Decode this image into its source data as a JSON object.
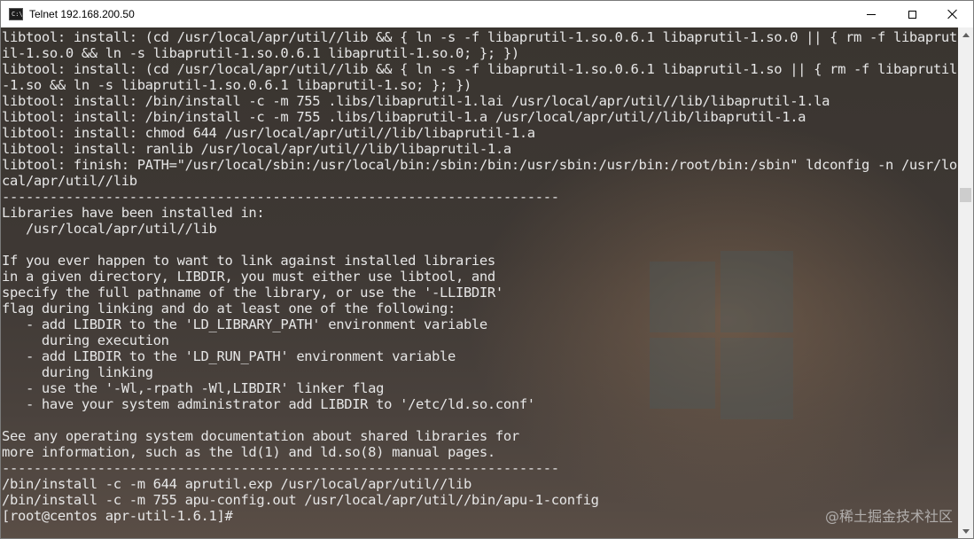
{
  "window": {
    "title": "Telnet 192.168.200.50",
    "app_icon_text": "C:\\",
    "controls": [
      "minimize",
      "maximize",
      "close"
    ]
  },
  "terminal": {
    "lines": [
      "libtool: install: (cd /usr/local/apr/util//lib && { ln -s -f libaprutil-1.so.0.6.1 libaprutil-1.so.0 || { rm -f libaprut",
      "il-1.so.0 && ln -s libaprutil-1.so.0.6.1 libaprutil-1.so.0; }; })",
      "libtool: install: (cd /usr/local/apr/util//lib && { ln -s -f libaprutil-1.so.0.6.1 libaprutil-1.so || { rm -f libaprutil",
      "-1.so && ln -s libaprutil-1.so.0.6.1 libaprutil-1.so; }; })",
      "libtool: install: /bin/install -c -m 755 .libs/libaprutil-1.lai /usr/local/apr/util//lib/libaprutil-1.la",
      "libtool: install: /bin/install -c -m 755 .libs/libaprutil-1.a /usr/local/apr/util//lib/libaprutil-1.a",
      "libtool: install: chmod 644 /usr/local/apr/util//lib/libaprutil-1.a",
      "libtool: install: ranlib /usr/local/apr/util//lib/libaprutil-1.a",
      "libtool: finish: PATH=\"/usr/local/sbin:/usr/local/bin:/sbin:/bin:/usr/sbin:/usr/bin:/root/bin:/sbin\" ldconfig -n /usr/lo",
      "cal/apr/util//lib",
      "----------------------------------------------------------------------",
      "Libraries have been installed in:",
      "   /usr/local/apr/util//lib",
      "",
      "If you ever happen to want to link against installed libraries",
      "in a given directory, LIBDIR, you must either use libtool, and",
      "specify the full pathname of the library, or use the '-LLIBDIR'",
      "flag during linking and do at least one of the following:",
      "   - add LIBDIR to the 'LD_LIBRARY_PATH' environment variable",
      "     during execution",
      "   - add LIBDIR to the 'LD_RUN_PATH' environment variable",
      "     during linking",
      "   - use the '-Wl,-rpath -Wl,LIBDIR' linker flag",
      "   - have your system administrator add LIBDIR to '/etc/ld.so.conf'",
      "",
      "See any operating system documentation about shared libraries for",
      "more information, such as the ld(1) and ld.so(8) manual pages.",
      "----------------------------------------------------------------------",
      "/bin/install -c -m 644 aprutil.exp /usr/local/apr/util//lib",
      "/bin/install -c -m 755 apu-config.out /usr/local/apr/util//bin/apu-1-config",
      "[root@centos apr-util-1.6.1]#"
    ]
  },
  "watermark": "@稀土掘金技术社区",
  "colors": {
    "text": "#e6e6e6",
    "titlebar": "#ffffff",
    "scrollbar_track": "#f0f0f0",
    "scrollbar_thumb": "#cdcdcd"
  },
  "icons": [
    "console-app-icon",
    "minimize-icon",
    "maximize-icon",
    "close-icon",
    "scroll-up-arrow-icon",
    "scroll-down-arrow-icon"
  ]
}
